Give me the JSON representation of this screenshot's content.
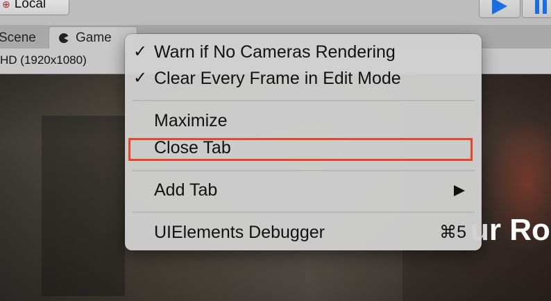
{
  "toolbar": {
    "pivot_button_label": "Local",
    "pivot_icon": "pivot-icon",
    "play_icon": "play-icon",
    "pause_icon": "pause-icon"
  },
  "tabs": {
    "scene_label": "Scene",
    "game_label": "Game",
    "game_icon": "pacman-icon"
  },
  "game_view": {
    "resolution": "HD (1920x1080)",
    "overlay_text": "ur Ro"
  },
  "context_menu": {
    "items": [
      {
        "label": "Warn if No Cameras Rendering",
        "checked": "✓"
      },
      {
        "label": "Clear Every Frame in Edit Mode",
        "checked": "✓"
      },
      {
        "label": "Maximize"
      },
      {
        "label": "Close Tab",
        "highlighted": true
      },
      {
        "label": "Add Tab",
        "submenu": true
      },
      {
        "label": "UIElements Debugger",
        "shortcut": "⌘5"
      }
    ]
  },
  "colors": {
    "highlight_box": "#e8442b",
    "play_blue": "#1b6ee0"
  }
}
